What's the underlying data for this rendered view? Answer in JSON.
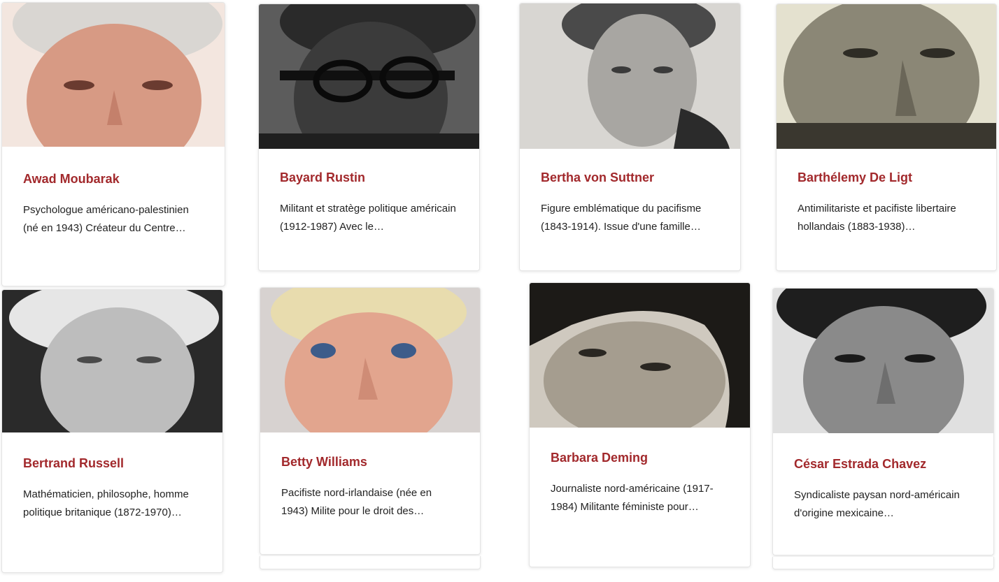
{
  "people": [
    {
      "name": "Awad Moubarak",
      "desc": "Psychologue américano-palestinien (né en 1943) Créateur du Centre…",
      "photo": "portrait-color"
    },
    {
      "name": "Bayard Rustin",
      "desc": "Militant et stratège politique américain (1912-1987) Avec le…",
      "photo": "portrait-bw"
    },
    {
      "name": "Bertha von Suttner",
      "desc": "Figure emblématique du pacifisme (1843-1914). Issue d'une famille…",
      "photo": "portrait-bw"
    },
    {
      "name": "Barthélemy De Ligt",
      "desc": "Antimilitariste et pacifiste libertaire hollandais (1883-1938)…",
      "photo": "portrait-sepia"
    },
    {
      "name": "Bertrand Russell",
      "desc": "Mathématicien, philosophe, homme politique britanique (1872-1970)…",
      "photo": "portrait-bw"
    },
    {
      "name": "Betty Williams",
      "desc": "Pacifiste nord-irlandaise (née en 1943) Milite pour le droit des…",
      "photo": "portrait-color"
    },
    {
      "name": "Barbara Deming",
      "desc": "Journaliste nord-américaine (1917-1984) Militante féministe pour…",
      "photo": "portrait-sepia"
    },
    {
      "name": "César Estrada Chavez",
      "desc": "Syndicaliste paysan nord-américain d'origine mexicaine…",
      "photo": "portrait-bw"
    }
  ],
  "colors": {
    "accent": "#a2292c",
    "text": "#222222",
    "border": "#e4e4e4"
  }
}
